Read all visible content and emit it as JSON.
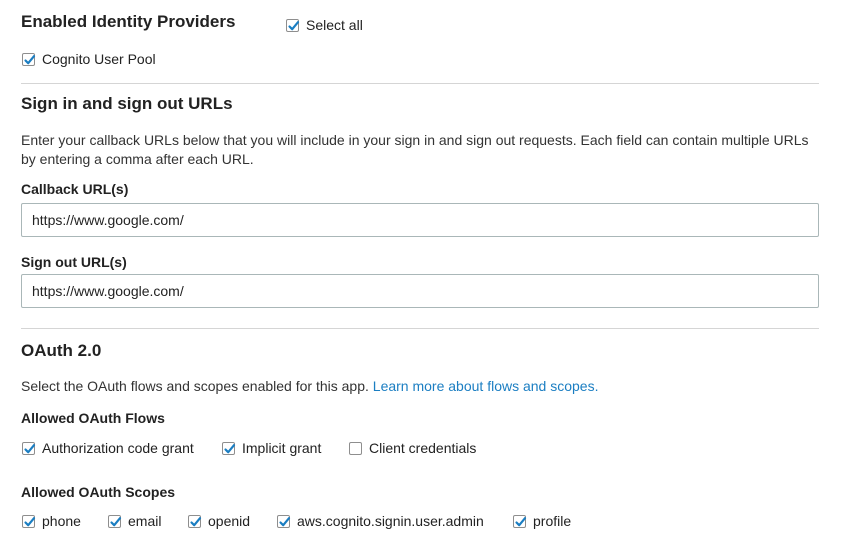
{
  "identity_providers": {
    "title": "Enabled Identity Providers",
    "select_all_label": "Select all",
    "select_all_checked": true,
    "providers": [
      {
        "label": "Cognito User Pool",
        "checked": true
      }
    ]
  },
  "urls": {
    "title": "Sign in and sign out URLs",
    "description": "Enter your callback URLs below that you will include in your sign in and sign out requests. Each field can contain multiple URLs by entering a comma after each URL.",
    "callback_label": "Callback URL(s)",
    "callback_value": "https://www.google.com/",
    "signout_label": "Sign out URL(s)",
    "signout_value": "https://www.google.com/"
  },
  "oauth": {
    "title": "OAuth 2.0",
    "description": "Select the OAuth flows and scopes enabled for this app.",
    "learn_more_link": "Learn more about flows and scopes.",
    "flows_label": "Allowed OAuth Flows",
    "flows": [
      {
        "label": "Authorization code grant",
        "checked": true
      },
      {
        "label": "Implicit grant",
        "checked": true
      },
      {
        "label": "Client credentials",
        "checked": false
      }
    ],
    "scopes_label": "Allowed OAuth Scopes",
    "scopes": [
      {
        "label": "phone",
        "checked": true
      },
      {
        "label": "email",
        "checked": true
      },
      {
        "label": "openid",
        "checked": true
      },
      {
        "label": "aws.cognito.signin.user.admin",
        "checked": true
      },
      {
        "label": "profile",
        "checked": true
      }
    ]
  },
  "colors": {
    "checkmark": "#1b7ec2",
    "link": "#1b7ec2",
    "divider": "#d5d5d5"
  },
  "icons": {
    "checkbox_checked": "checkmark-icon"
  }
}
